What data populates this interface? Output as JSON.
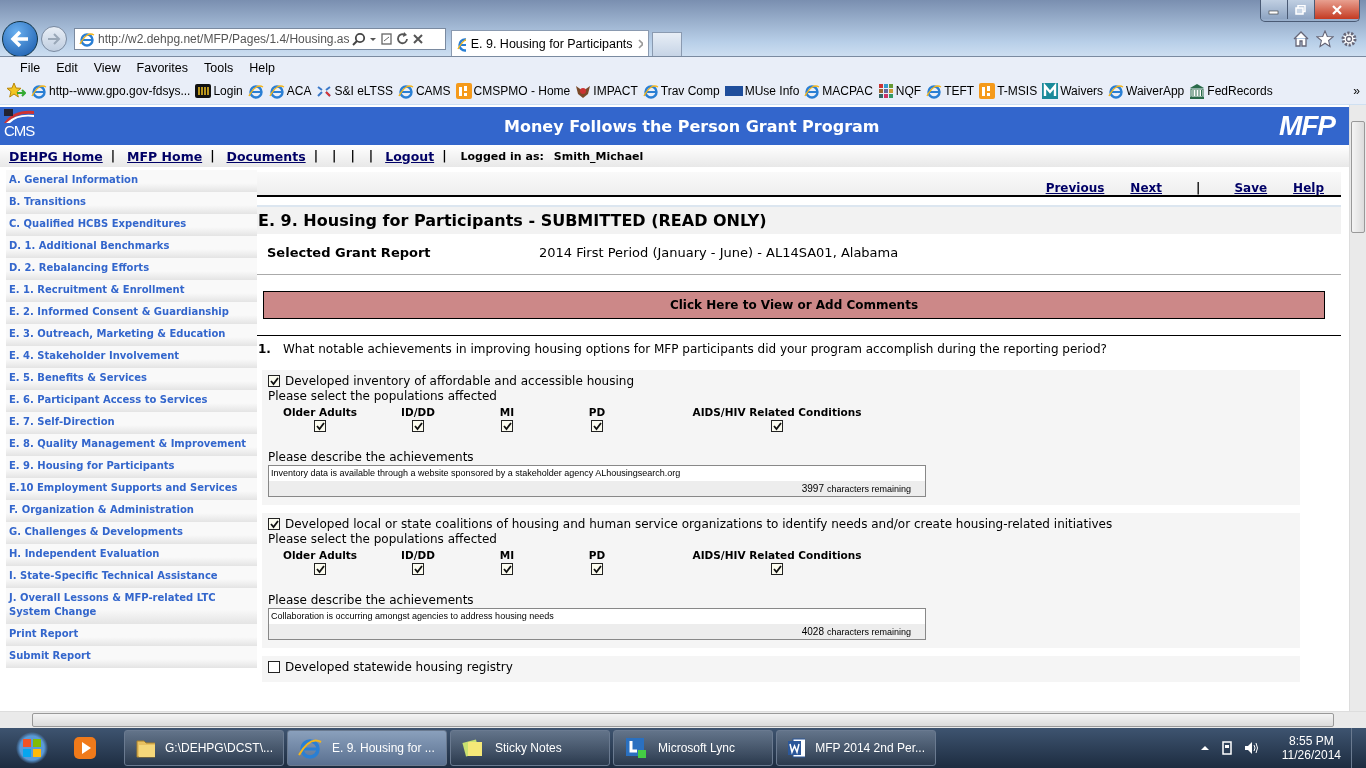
{
  "browser": {
    "address": "http://w2.dehpg.net/MFP/Pages/1.4/Housing.as",
    "tab": "E. 9. Housing for Participants",
    "menu": [
      "File",
      "Edit",
      "View",
      "Favorites",
      "Tools",
      "Help"
    ],
    "favorites": [
      {
        "kind": "ie",
        "label": "http--www.gpo.gov-fdsys..."
      },
      {
        "kind": "grid",
        "label": "Login"
      },
      {
        "kind": "ie"
      },
      {
        "kind": "ie",
        "label": "ACA"
      },
      {
        "kind": "arrows",
        "label": "S&I eLTSS"
      },
      {
        "kind": "ie",
        "label": "CAMS"
      },
      {
        "kind": "orange",
        "label": "CMSPMO - Home"
      },
      {
        "kind": "seal",
        "label": "IMPACT"
      },
      {
        "kind": "ie",
        "label": "Trav Comp"
      },
      {
        "kind": "cdc",
        "label": "MUse Info"
      },
      {
        "kind": "ie",
        "label": "MACPAC"
      },
      {
        "kind": "dots",
        "label": "NQF"
      },
      {
        "kind": "ie",
        "label": "TEFT"
      },
      {
        "kind": "orange",
        "label": "T-MSIS"
      },
      {
        "kind": "m",
        "label": "Waivers"
      },
      {
        "kind": "ie",
        "label": "WaiverApp"
      },
      {
        "kind": "building",
        "label": "FedRecords"
      }
    ],
    "overflow": "»"
  },
  "page": {
    "logo": "CMS",
    "title": "Money Follows the Person Grant Program",
    "mfp_logo": "MFP",
    "nav": [
      {
        "kind": "link",
        "label": "DEHPG Home"
      },
      {
        "kind": "sep",
        "label": "|"
      },
      {
        "kind": "link",
        "label": "MFP Home"
      },
      {
        "kind": "sep",
        "label": "|"
      },
      {
        "kind": "link",
        "label": "Documents"
      },
      {
        "kind": "sep",
        "label": "|"
      },
      {
        "kind": "sep",
        "label": "|"
      },
      {
        "kind": "sep",
        "label": "|"
      },
      {
        "kind": "sep",
        "label": "|"
      },
      {
        "kind": "link",
        "label": "Logout"
      },
      {
        "kind": "sep",
        "label": "|"
      }
    ],
    "logged_in_label": "Logged in as:",
    "user": "Smith_Michael",
    "sidebar": [
      "A. General Information",
      "B. Transitions",
      "C. Qualified HCBS Expenditures",
      "D. 1. Additional Benchmarks",
      "D. 2. Rebalancing Efforts",
      "E. 1. Recruitment & Enrollment",
      "E. 2. Informed Consent & Guardianship",
      "E. 3. Outreach, Marketing & Education",
      "E. 4. Stakeholder Involvement",
      "E. 5. Benefits & Services",
      "E. 6. Participant Access to Services",
      "E. 7. Self-Direction",
      "E. 8. Quality Management & Improvement",
      "E. 9. Housing for Participants",
      "E.10 Employment Supports and Services",
      "F. Organization & Administration",
      "G. Challenges & Developments",
      "H. Independent Evaluation",
      "I. State-Specific Technical Assistance",
      "J. Overall Lessons & MFP-related LTC System Change",
      "Print Report",
      "Submit Report"
    ],
    "toolbar": [
      {
        "kind": "link",
        "label": "Previous"
      },
      {
        "kind": "link",
        "label": "Next"
      },
      {
        "kind": "sep",
        "label": "|"
      },
      {
        "kind": "link",
        "label": "Save"
      },
      {
        "kind": "link",
        "label": "Help"
      }
    ],
    "heading": "E. 9. Housing for Participants - SUBMITTED (READ ONLY)",
    "grant_label": "Selected Grant Report",
    "grant_value": "2014 First Period (January - June) - AL14SA01, Alabama",
    "comments_button": "Click Here to View or Add Comments",
    "question_number": "1.",
    "question": "What notable achievements in improving housing options for MFP participants did your program accomplish during the reporting period?",
    "options": [
      {
        "label": "Developed inventory of affordable and accessible housing",
        "checked": true,
        "populations_label": "Please select the populations affected",
        "populations": [
          {
            "label": "Older Adults",
            "checked": true
          },
          {
            "label": "ID/DD",
            "checked": true
          },
          {
            "label": "MI",
            "checked": true
          },
          {
            "label": "PD",
            "checked": true
          },
          {
            "label": "AIDS/HIV Related Conditions",
            "checked": true
          }
        ],
        "describe_label": "Please describe the achievements",
        "answer": "Inventory data is available through a website sponsored by a stakeholder agency ALhousingsearch.org",
        "remaining": "3997",
        "remaining_label": "characters remaining"
      },
      {
        "label": "Developed local or state coalitions of housing and human service organizations to identify needs and/or create housing-related initiatives",
        "checked": true,
        "populations_label": "Please select the populations affected",
        "populations": [
          {
            "label": "Older Adults",
            "checked": true
          },
          {
            "label": "ID/DD",
            "checked": true
          },
          {
            "label": "MI",
            "checked": true
          },
          {
            "label": "PD",
            "checked": true
          },
          {
            "label": "AIDS/HIV Related Conditions",
            "checked": true
          }
        ],
        "describe_label": "Please describe the achievements",
        "answer": "Collaboration is occurring amongst agencies to address housing needs",
        "remaining": "4028",
        "remaining_label": "characters remaining"
      },
      {
        "label": "Developed statewide housing registry",
        "checked": false
      }
    ]
  },
  "taskbar": {
    "tasks": [
      {
        "kind": "folder",
        "label": "G:\\DEHPG\\DCST\\...",
        "selected": false
      },
      {
        "kind": "ie",
        "label": "E. 9. Housing for ...",
        "selected": true
      },
      {
        "kind": "notes",
        "label": "Sticky Notes",
        "selected": false
      },
      {
        "kind": "lync",
        "label": "Microsoft Lync",
        "selected": false
      },
      {
        "kind": "word",
        "label": "MFP 2014 2nd Per...",
        "selected": false
      }
    ],
    "time": "8:55 PM",
    "date": "11/26/2014"
  }
}
